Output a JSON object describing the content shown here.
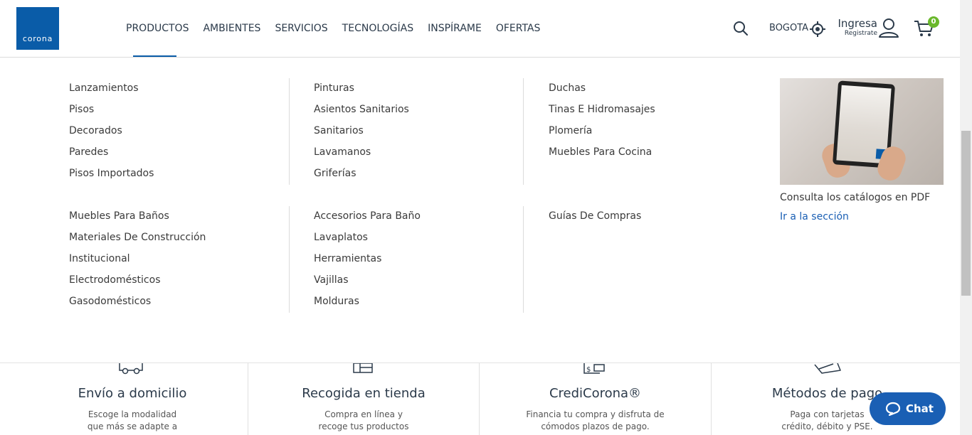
{
  "brand": {
    "logo_text": "corona",
    "color": "#0a5ca8"
  },
  "nav": {
    "items": [
      "PRODUCTOS",
      "AMBIENTES",
      "SERVICIOS",
      "TECNOLOGÍAS",
      "INSPÍRAME",
      "OFERTAS"
    ],
    "active": "PRODUCTOS"
  },
  "header": {
    "city": "BOGOTA",
    "login": "Ingresa",
    "register": "Registrate",
    "cart_count": "0",
    "icons": [
      "search-icon",
      "location-target-icon",
      "user-icon",
      "cart-icon"
    ]
  },
  "menu": {
    "col1a": [
      "Lanzamientos",
      "Pisos",
      "Decorados",
      "Paredes",
      "Pisos Importados"
    ],
    "col2a": [
      "Pinturas",
      "Asientos Sanitarios",
      "Sanitarios",
      "Lavamanos",
      "Griferías"
    ],
    "col3a": [
      "Duchas",
      "Tinas E Hidromasajes",
      "Plomería",
      "Muebles Para Cocina"
    ],
    "col1b": [
      "Muebles Para Baños",
      "Materiales De Construcción",
      "Institucional",
      "Electrodomésticos",
      "Gasodomésticos"
    ],
    "col2b": [
      "Accesorios Para Baño",
      "Lavaplatos",
      "Herramientas",
      "Vajillas",
      "Molduras"
    ],
    "col3b": [
      "Guías De Compras"
    ]
  },
  "promo": {
    "title": "Consulta los catálogos en PDF",
    "link": "Ir a la sección"
  },
  "services": [
    {
      "title": "Envío a domicilio",
      "line1": "Escoge la modalidad",
      "line2": "que más se adapte a",
      "icon": "truck-icon"
    },
    {
      "title": "Recogida en tienda",
      "line1": "Compra en línea y",
      "line2": "recoge tus productos",
      "icon": "store-icon"
    },
    {
      "title": "CrediCorona®",
      "line1": "Financia tu compra y disfruta de",
      "line2": "cómodos plazos de pago.",
      "icon": "credit-icon"
    },
    {
      "title": "Métodos de pago",
      "line1": "Paga con tarjetas",
      "line2": "crédito, débito y PSE.",
      "icon": "card-icon"
    }
  ],
  "chat": {
    "label": "Chat",
    "icon": "chat-bubble-icon",
    "color": "#1a5fb4"
  }
}
